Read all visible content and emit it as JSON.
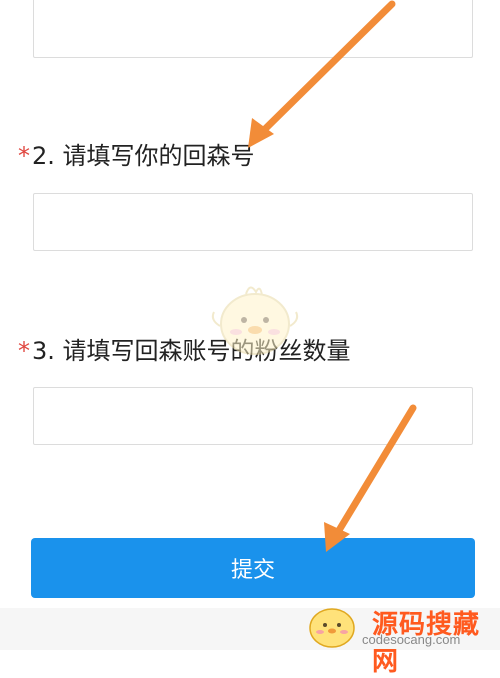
{
  "form": {
    "questions": [
      {
        "required_mark": "*",
        "label": "2. 请填写你的回森号",
        "value": "",
        "placeholder": ""
      },
      {
        "required_mark": "*",
        "label": "3. 请填写回森账号的粉丝数量",
        "value": "",
        "placeholder": ""
      }
    ],
    "submit_label": "提交"
  },
  "watermark": {
    "site_name": "源码搜藏网",
    "url": "codesocang.com"
  },
  "colors": {
    "accent": "#1a92ec",
    "required": "#e0463f",
    "arrow": "#f28c38",
    "watermark": "#ff5a1f"
  }
}
